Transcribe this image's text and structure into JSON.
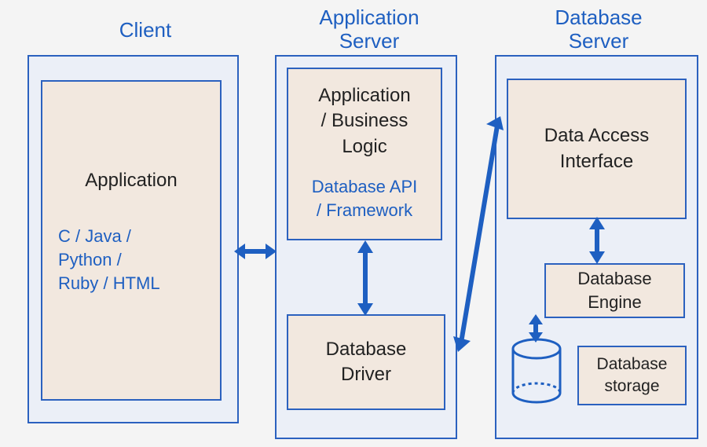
{
  "columns": {
    "client": {
      "title": "Client",
      "box": {
        "heading": "Application",
        "tech": "C / Java /\nPython /\nRuby / HTML"
      }
    },
    "appServer": {
      "title": "Application\nServer",
      "logicBox": {
        "heading": "Application\n/ Business\nLogic",
        "api": "Database API\n/ Framework"
      },
      "driverBox": {
        "heading": "Database\nDriver"
      }
    },
    "dbServer": {
      "title": "Database\nServer",
      "accessBox": {
        "heading": "Data Access\nInterface"
      },
      "engineBox": {
        "heading": "Database\nEngine"
      },
      "storageBox": {
        "heading": "Database\nstorage"
      }
    }
  },
  "connectors": [
    {
      "from": "client.box",
      "to": "appServer.logicBox",
      "style": "double-arrow-horizontal"
    },
    {
      "from": "appServer.logicBox",
      "to": "appServer.driverBox",
      "style": "double-arrow-vertical"
    },
    {
      "from": "appServer.driverBox",
      "to": "dbServer.accessBox",
      "style": "double-arrow-diagonal"
    },
    {
      "from": "dbServer.accessBox",
      "to": "dbServer.engineBox",
      "style": "double-arrow-vertical"
    },
    {
      "from": "dbServer.engineBox",
      "to": "dbServer.storage",
      "style": "double-arrow-vertical"
    }
  ],
  "shapes": [
    {
      "name": "database-cylinder",
      "meaning": "storage"
    }
  ]
}
